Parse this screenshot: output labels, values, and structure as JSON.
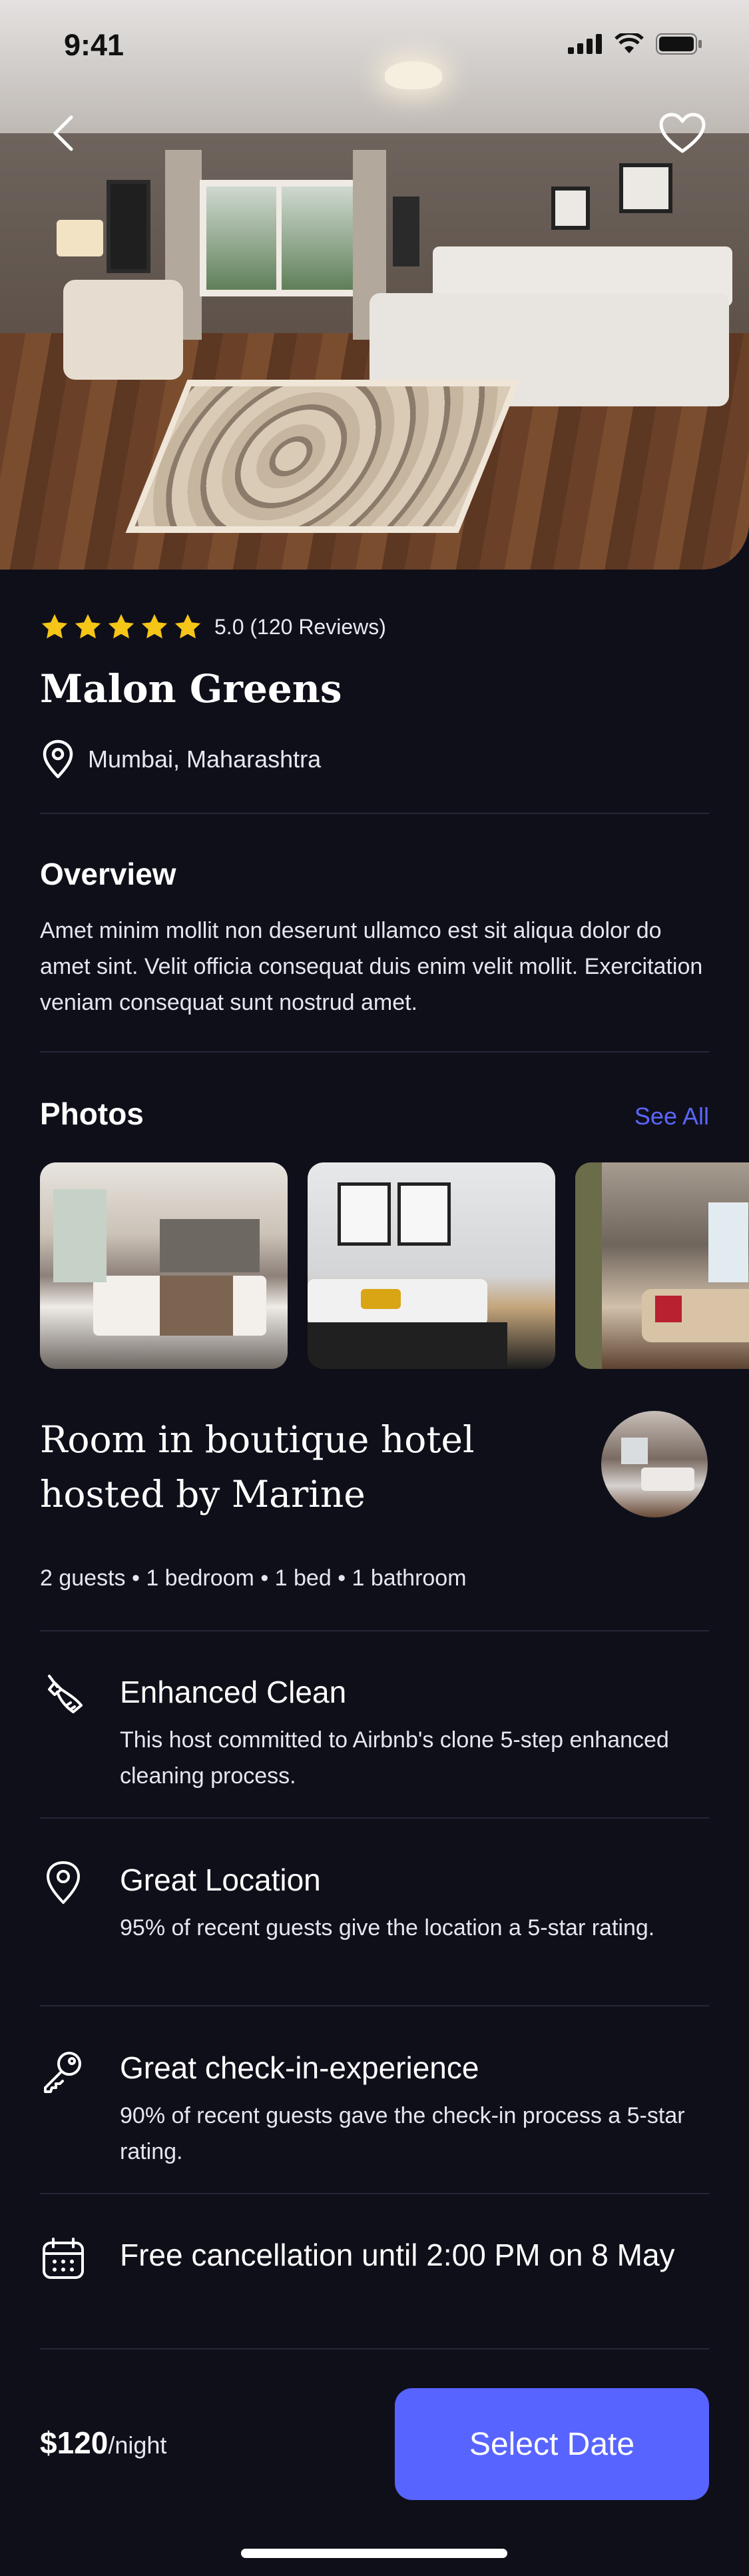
{
  "status_bar": {
    "time": "9:41"
  },
  "listing": {
    "rating": "5.0",
    "reviews": "(120 Reviews)",
    "name": "Malon Greens",
    "location": "Mumbai, Maharashtra",
    "stars": 5
  },
  "overview": {
    "title": "Overview",
    "text": "Amet minim mollit non deserunt ullamco est sit aliqua dolor do amet sint. Velit officia consequat duis enim velit mollit. Exercitation veniam consequat sunt nostrud amet."
  },
  "photos": {
    "title": "Photos",
    "see_all": "See All"
  },
  "host": {
    "title": "Room in boutique hotel hosted by Marine",
    "guest_info": "2 guests • 1 bedroom • 1 bed • 1 bathroom"
  },
  "features": [
    {
      "icon": "broom-icon",
      "title": "Enhanced Clean",
      "desc": "This host committed to Airbnb's clone 5-step enhanced cleaning process."
    },
    {
      "icon": "location-pin-icon",
      "title": "Great Location",
      "desc": "95% of recent guests give the location a 5-star rating."
    },
    {
      "icon": "key-icon",
      "title": "Great check-in-experience",
      "desc": "90% of recent guests gave the check-in process a 5-star rating."
    },
    {
      "icon": "calendar-icon",
      "title": "Free cancellation until 2:00 PM on 8 May",
      "desc": ""
    }
  ],
  "booking": {
    "price": "$120",
    "unit": "/night",
    "button": "Select Date"
  },
  "colors": {
    "background": "#0f0f1a",
    "accent": "#5864ff",
    "star": "#f5c518",
    "divider": "#262637"
  }
}
